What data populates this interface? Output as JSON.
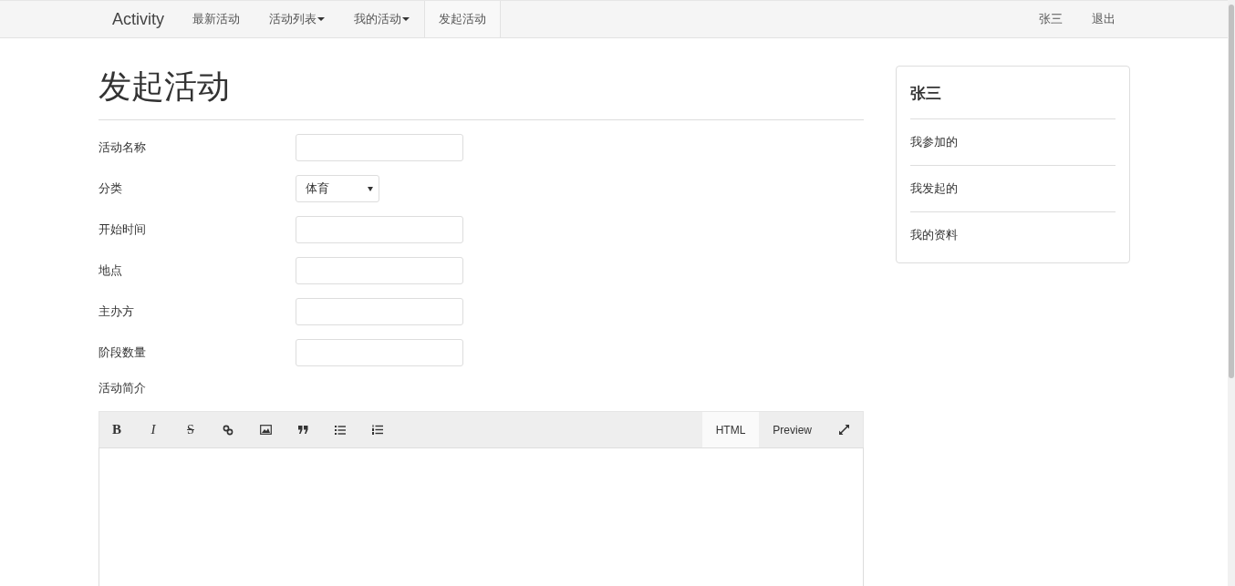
{
  "navbar": {
    "brand": "Activity",
    "items": [
      {
        "label": "最新活动",
        "dropdown": false,
        "selected": false
      },
      {
        "label": "活动列表",
        "dropdown": true,
        "selected": false
      },
      {
        "label": "我的活动",
        "dropdown": true,
        "selected": false
      },
      {
        "label": "发起活动",
        "dropdown": false,
        "selected": true
      }
    ],
    "right_items": [
      "张三",
      "退出"
    ]
  },
  "page_title": "发起活动",
  "form": {
    "fields": [
      {
        "label": "活动名称",
        "kind": "text"
      },
      {
        "label": "分类",
        "kind": "select",
        "value": "体育"
      },
      {
        "label": "开始时间",
        "kind": "text"
      },
      {
        "label": "地点",
        "kind": "text"
      },
      {
        "label": "主办方",
        "kind": "text"
      },
      {
        "label": "阶段数量",
        "kind": "text"
      }
    ],
    "description_label": "活动简介",
    "editor": {
      "toolbar": [
        {
          "kind": "bold",
          "text": "B"
        },
        {
          "kind": "italic",
          "text": "I"
        },
        {
          "kind": "strike",
          "text": "S"
        },
        {
          "kind": "link"
        },
        {
          "kind": "image"
        },
        {
          "kind": "quote"
        },
        {
          "kind": "ul"
        },
        {
          "kind": "ol"
        }
      ],
      "tabs": [
        {
          "label": "HTML",
          "selected": true
        },
        {
          "label": "Preview",
          "selected": false
        }
      ]
    }
  },
  "sidebar": {
    "title": "张三",
    "items": [
      "我参加的",
      "我发起的",
      "我的资料"
    ]
  }
}
